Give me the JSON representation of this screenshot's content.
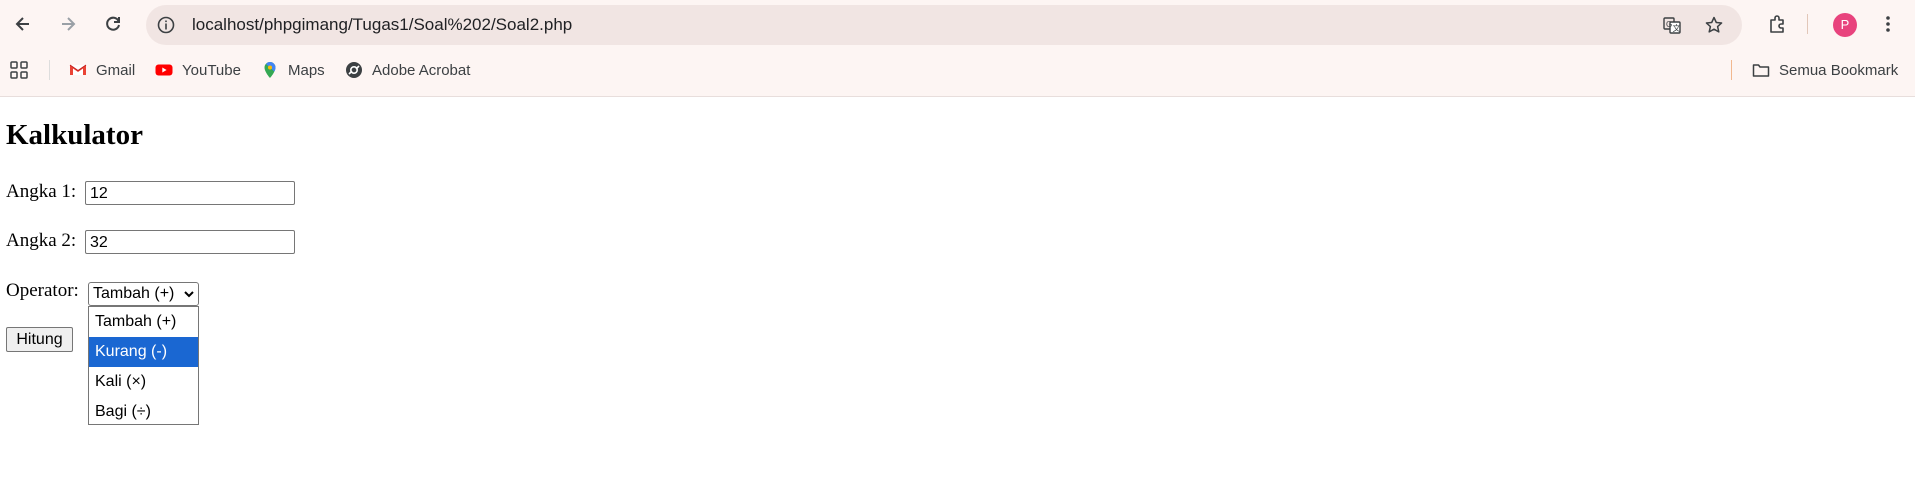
{
  "browser": {
    "url": "localhost/phpgimang/Tugas1/Soal%202/Soal2.php",
    "profile_initial": "P",
    "bookmarks": [
      {
        "label": "Gmail",
        "icon": "gmail-icon"
      },
      {
        "label": "YouTube",
        "icon": "youtube-icon"
      },
      {
        "label": "Maps",
        "icon": "maps-icon"
      },
      {
        "label": "Adobe Acrobat",
        "icon": "acrobat-icon"
      }
    ],
    "all_bookmarks_label": "Semua Bookmark"
  },
  "page": {
    "title": "Kalkulator",
    "angka1_label": "Angka 1:",
    "angka1_value": "12",
    "angka2_label": "Angka 2:",
    "angka2_value": "32",
    "operator_label": "Operator:",
    "operator_selected": "Tambah (+)",
    "operator_options": [
      "Tambah (+)",
      "Kurang (-)",
      "Kali (×)",
      "Bagi (÷)"
    ],
    "highlighted_option": "Kurang (-)",
    "submit_label": "Hitung"
  },
  "colors": {
    "highlight": "#1a67d2",
    "avatar": "#e8437d",
    "chrome_background": "#fdf5f3"
  }
}
